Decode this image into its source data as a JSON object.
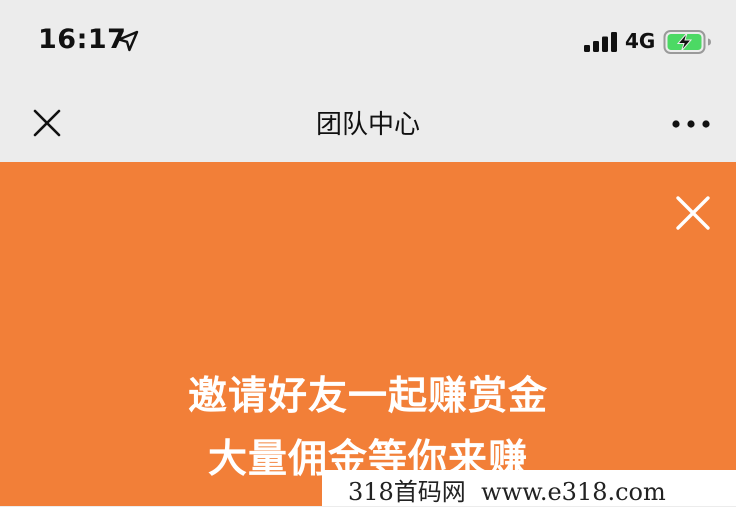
{
  "status_bar": {
    "time": "16:17",
    "network": "4G",
    "icons": [
      "location-arrow-icon",
      "signal-bars-icon",
      "battery-charging-icon"
    ],
    "battery_color": "#4cd964"
  },
  "nav": {
    "title": "团队中心",
    "close_icon": "close-icon",
    "more_icon": "more-dots-icon",
    "background": "#ececec"
  },
  "banner": {
    "line1": "邀请好友一起赚赏金",
    "line2": "大量佣金等你来赚",
    "close_icon": "close-icon",
    "background": "#f27f38"
  },
  "watermark": {
    "text": "318首码网  www.e318.com"
  }
}
